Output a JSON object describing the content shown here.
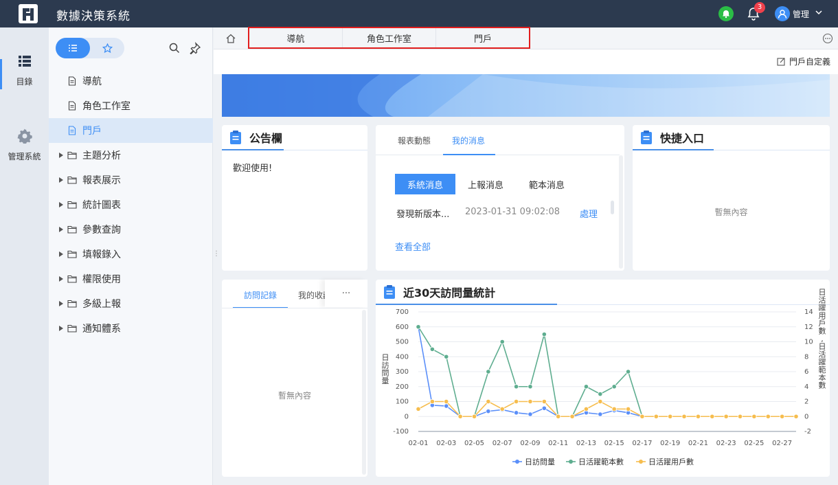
{
  "app": {
    "title": "數據決策系統",
    "user": "管理",
    "notification_count": "3"
  },
  "rail": {
    "items": [
      {
        "label": "目錄",
        "icon": "list-icon"
      },
      {
        "label": "管理系統",
        "icon": "gear-icon"
      }
    ]
  },
  "sidebar": {
    "items": [
      {
        "label": "導航",
        "type": "file",
        "active": false
      },
      {
        "label": "角色工作室",
        "type": "file",
        "active": false
      },
      {
        "label": "門戶",
        "type": "file",
        "active": true
      },
      {
        "label": "主題分析",
        "type": "folder",
        "active": false
      },
      {
        "label": "報表展示",
        "type": "folder",
        "active": false
      },
      {
        "label": "統計圖表",
        "type": "folder",
        "active": false
      },
      {
        "label": "參數查詢",
        "type": "folder",
        "active": false
      },
      {
        "label": "填報錄入",
        "type": "folder",
        "active": false
      },
      {
        "label": "權限使用",
        "type": "folder",
        "active": false
      },
      {
        "label": "多級上報",
        "type": "folder",
        "active": false
      },
      {
        "label": "通知體系",
        "type": "folder",
        "active": false
      }
    ]
  },
  "tabs": [
    {
      "label": "導航"
    },
    {
      "label": "角色工作室"
    },
    {
      "label": "門戶"
    }
  ],
  "toolbar": {
    "customize_label": "門戶自定義"
  },
  "bulletin": {
    "title": "公告欄",
    "content": "歡迎使用!"
  },
  "messages": {
    "tabs": [
      "報表動態",
      "我的消息"
    ],
    "active_tab": "我的消息",
    "filters": [
      "系統消息",
      "上報消息",
      "範本消息"
    ],
    "active_filter": "系統消息",
    "item": {
      "text": "發現新版本...",
      "time": "2023-01-31 09:02:08",
      "action": "處理"
    },
    "view_all": "查看全部"
  },
  "shortcuts": {
    "title": "快捷入口",
    "empty": "暫無內容"
  },
  "visits": {
    "tabs": [
      "訪問記錄",
      "我的收藏"
    ],
    "more": "···",
    "empty": "暫無內容"
  },
  "colors": {
    "primary": "#3d8ef5",
    "topbar": "#2c3a4f",
    "highlight": "#e21d1d",
    "series_blue": "#5b8ff9",
    "series_green": "#5ead8f",
    "series_yellow": "#f6bd4e"
  },
  "chart_data": {
    "type": "line",
    "title": "近30天訪問量統計",
    "categories": [
      "02-01",
      "02-02",
      "02-03",
      "02-04",
      "02-05",
      "02-06",
      "02-07",
      "02-08",
      "02-09",
      "02-10",
      "02-11",
      "02-12",
      "02-13",
      "02-14",
      "02-15",
      "02-16",
      "02-17",
      "02-18",
      "02-19",
      "02-20",
      "02-21",
      "02-22",
      "02-23",
      "02-24",
      "02-25",
      "02-26",
      "02-27",
      "02-28"
    ],
    "tick_labels": [
      "02-01",
      "02-03",
      "02-05",
      "02-07",
      "02-09",
      "02-11",
      "02-13",
      "02-15",
      "02-17",
      "02-19",
      "02-21",
      "02-23",
      "02-25",
      "02-27"
    ],
    "ylabel_left": "日訪問量",
    "ylabel_right": "日活躍用戶數,日活躍範本數",
    "ylim_left": [
      -100,
      700
    ],
    "yticks_left": [
      -100,
      0,
      100,
      200,
      300,
      400,
      500,
      600,
      700
    ],
    "ylim_right": [
      -2,
      14
    ],
    "yticks_right": [
      -2,
      0,
      2,
      4,
      6,
      8,
      10,
      12,
      14
    ],
    "grid": true,
    "legend_position": "bottom",
    "series": [
      {
        "name": "日訪問量",
        "axis": "left",
        "values": [
          600,
          75,
          70,
          0,
          0,
          35,
          45,
          25,
          15,
          55,
          0,
          0,
          25,
          15,
          40,
          25,
          0,
          0,
          0,
          0,
          0,
          0,
          0,
          0,
          0,
          0,
          0,
          0
        ]
      },
      {
        "name": "日活躍範本數",
        "axis": "right",
        "values": [
          12,
          9,
          8,
          0,
          0,
          6,
          10,
          4,
          4,
          11,
          0,
          0,
          4,
          3,
          4,
          6,
          0,
          0,
          0,
          0,
          0,
          0,
          0,
          0,
          0,
          0,
          0,
          0
        ]
      },
      {
        "name": "日活躍用戶數",
        "axis": "right",
        "values": [
          1,
          2,
          2,
          0,
          0,
          2,
          1,
          2,
          2,
          2,
          0,
          0,
          1,
          2,
          1,
          1,
          0,
          0,
          0,
          0,
          0,
          0,
          0,
          0,
          0,
          0,
          0,
          0
        ]
      }
    ]
  }
}
